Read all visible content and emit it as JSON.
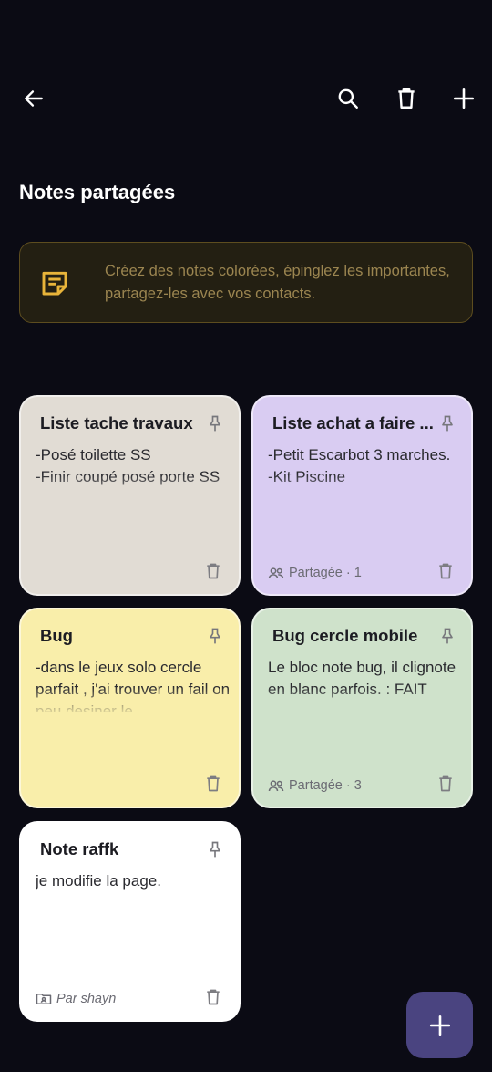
{
  "header": {
    "title": "Notes partagées"
  },
  "banner": {
    "text": "Créez des notes colorées, épinglez les importantes, partagez-les avec vos contacts.",
    "accent": "#e8b43a"
  },
  "notes": [
    {
      "title": "Liste tache travaux",
      "body": "-Posé toilette SS\n-Finir coupé posé porte SS",
      "color": "#e1dcd4",
      "footer": ""
    },
    {
      "title": "Liste achat a faire ...",
      "body": "-Petit Escarbot 3 marches.\n-Kit Piscine",
      "color": "#d9ccf2",
      "footer": "Partagée · 1"
    },
    {
      "title": "Bug",
      "body": "-dans le jeux solo cercle parfait , j'ai trouver un fail on peu desiner le",
      "color": "#f9eeaa",
      "footer": ""
    },
    {
      "title": "Bug cercle mobile",
      "body": "Le bloc note bug, il clignote en blanc parfois. : FAIT",
      "color": "#cfe2cb",
      "footer": "Partagée · 3"
    },
    {
      "title": "Note raffk",
      "body": "je modifie la page.",
      "color": "#ffffff",
      "footer": "Par shayn"
    }
  ],
  "icons": {
    "back": "arrow-left-icon",
    "search": "search-icon",
    "delete": "trash-icon",
    "add": "plus-icon",
    "fab": "plus-icon"
  },
  "colors": {
    "background": "#0b0b14",
    "fab": "#4a4480"
  }
}
